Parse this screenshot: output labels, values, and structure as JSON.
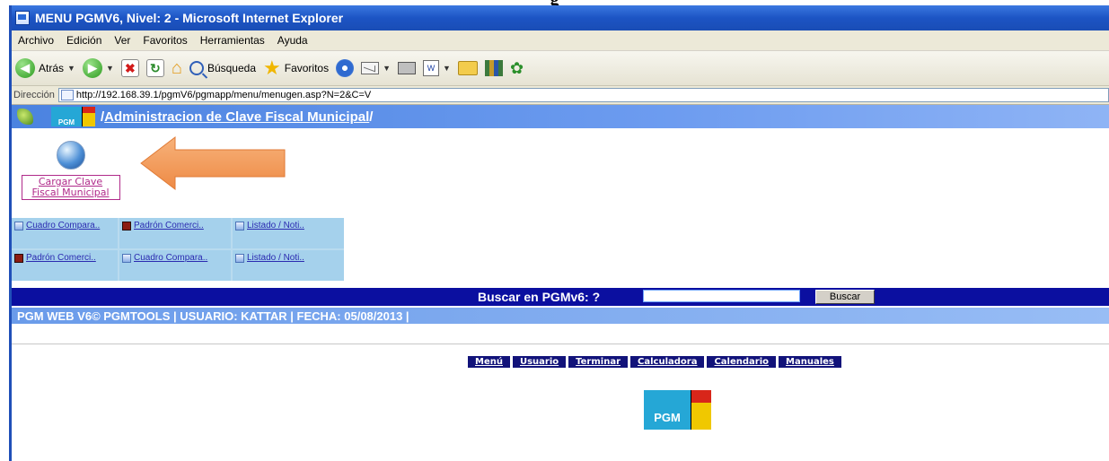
{
  "document": {
    "heading": "g"
  },
  "window": {
    "title": "MENU PGMV6, Nivel: 2 - Microsoft Internet Explorer"
  },
  "menubar": {
    "items": [
      "Archivo",
      "Edición",
      "Ver",
      "Favoritos",
      "Herramientas",
      "Ayuda"
    ]
  },
  "toolbar": {
    "back_label": "Atrás",
    "search_label": "Búsqueda",
    "favorites_label": "Favoritos"
  },
  "address": {
    "label": "Dirección",
    "url": "http://192.168.39.1/pgmV6/pgmapp/menu/menugen.asp?N=2&C=V"
  },
  "app": {
    "logo_text": "PGM",
    "header_title": "Administracion de Clave Fiscal Municipal",
    "header_prefix": "/",
    "header_suffix": " /",
    "main_item_line1": "Cargar Clave",
    "main_item_line2": "Fiscal Municipal"
  },
  "shortcuts": [
    {
      "label": "Cuadro Compara..",
      "icon": "sheet-icon"
    },
    {
      "label": "Padrón Comerci..",
      "icon": "brick-icon"
    },
    {
      "label": "Listado / Noti..",
      "icon": "sheet-icon"
    },
    {
      "label": "Padrón Comerci..",
      "icon": "brick-icon"
    },
    {
      "label": "Cuadro Compara..",
      "icon": "sheet-icon"
    },
    {
      "label": "Listado / Noti..",
      "icon": "sheet-icon"
    }
  ],
  "search": {
    "label": "Buscar en PGMv6: ?",
    "value": "",
    "button_label": "Buscar"
  },
  "footer": {
    "text": "PGM WEB V6© PGMTOOLS | USUARIO: KATTAR | FECHA: 05/08/2013 |"
  },
  "nav_links": [
    "Menú",
    "Usuario",
    "Terminar",
    "Calculadora",
    "Calendario",
    "Manuales"
  ],
  "colors": {
    "header_blue": "#4b83e0",
    "search_bar_navy": "#0b0fa0",
    "arrow_orange": "#f09a5a",
    "link_magenta": "#b02a8a"
  }
}
